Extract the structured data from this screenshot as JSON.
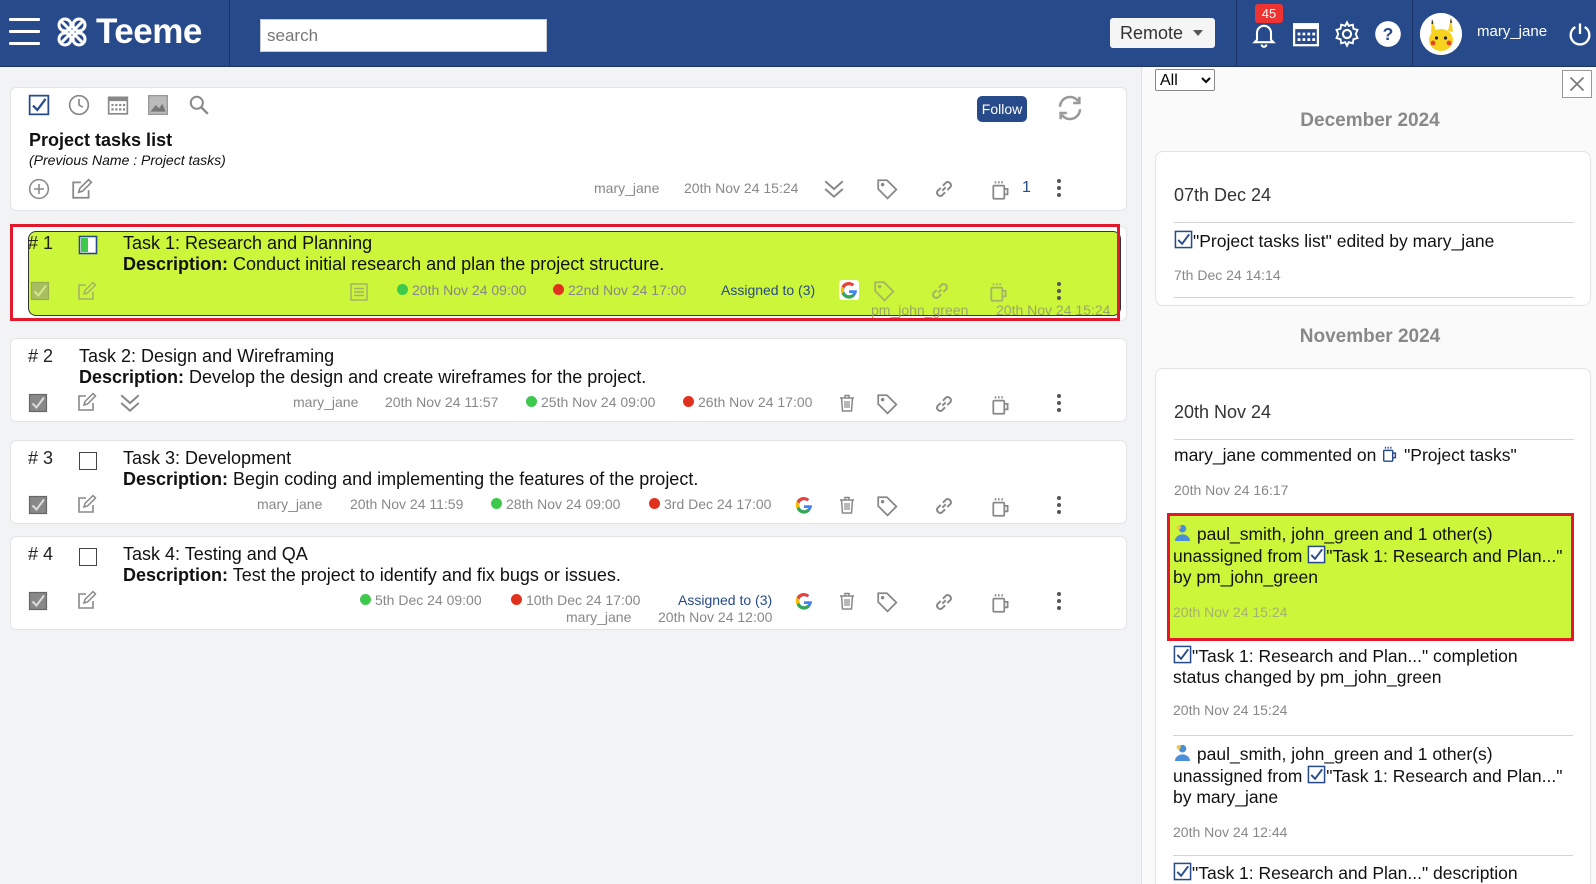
{
  "app": {
    "name": "Teeme"
  },
  "header": {
    "search_placeholder": "search",
    "mode": "Remote",
    "notification_count": "45",
    "username": "mary_jane"
  },
  "list": {
    "title": "Project tasks list",
    "subtitle": "(Previous Name    : Project tasks)",
    "follow_label": "Follow",
    "owner": "mary_jane",
    "created": "20th Nov 24 15:24",
    "comment_count": "1"
  },
  "tasks": [
    {
      "num": "# 1",
      "title": "Task 1: Research and Planning",
      "desc_label": "Description:",
      "desc": "Conduct initial research and plan the project structure.",
      "start": "20th Nov 24 09:00",
      "end": "22nd Nov 24 17:00",
      "assigned": "Assigned to (3)",
      "author": "pm_john_green",
      "modified": "20th Nov 24 15:24"
    },
    {
      "num": "# 2",
      "title": "Task 2: Design and Wireframing",
      "desc_label": "Description:",
      "desc": "Develop the design and create wireframes for the project.",
      "author": "mary_jane",
      "modified": "20th Nov 24 11:57",
      "start": "25th Nov 24 09:00",
      "end": "26th Nov 24 17:00"
    },
    {
      "num": "# 3",
      "title": "Task 3: Development",
      "desc_label": "Description:",
      "desc": "Begin coding and implementing the features of the project.",
      "author": "mary_jane",
      "modified": "20th Nov 24 11:59",
      "start": "28th Nov 24 09:00",
      "end": "3rd Dec 24 17:00"
    },
    {
      "num": "# 4",
      "title": "Task 4: Testing and QA",
      "desc_label": "Description:",
      "desc": "Test the project to identify and fix bugs or issues.",
      "start": "5th Dec 24 09:00",
      "end": "10th Dec 24 17:00",
      "assigned": "Assigned to (3)",
      "author": "mary_jane",
      "modified": "20th Nov 24 12:00"
    }
  ],
  "activity": {
    "filter": "All",
    "filter_options": [
      "All"
    ],
    "months": [
      "December 2024",
      "November 2024"
    ],
    "dec": {
      "date": "07th Dec 24",
      "items": [
        {
          "text": "\"Project tasks list\" edited by mary_jane",
          "time": "7th Dec 24 14:14"
        }
      ]
    },
    "nov": {
      "date": "20th Nov 24",
      "items": [
        {
          "pre": "mary_jane commented on ",
          "text": "\"Project tasks\"",
          "time": "20th Nov 24 16:17"
        },
        {
          "line1": "paul_smith, john_green and 1 other(s)",
          "line2a": "unassigned from ",
          "line2b": "\"Task 1: Research and Plan...\"",
          "line3": "by pm_john_green",
          "time": "20th Nov 24 15:24"
        },
        {
          "line1": "\"Task 1: Research and Plan...\" completion",
          "line2": "status changed by pm_john_green",
          "time": "20th Nov 24 15:24"
        },
        {
          "line1": "paul_smith, john_green and 1 other(s)",
          "line2a": "unassigned from ",
          "line2b": "\"Task 1: Research and Plan...\"",
          "line3": "by mary_jane",
          "time": "20th Nov 24 12:44"
        },
        {
          "line1": "\"Task 1: Research and Plan...\" description"
        }
      ]
    }
  },
  "colors": {
    "brand": "#274a8a",
    "highlight": "#ccf63a",
    "alert": "#e3192b"
  }
}
